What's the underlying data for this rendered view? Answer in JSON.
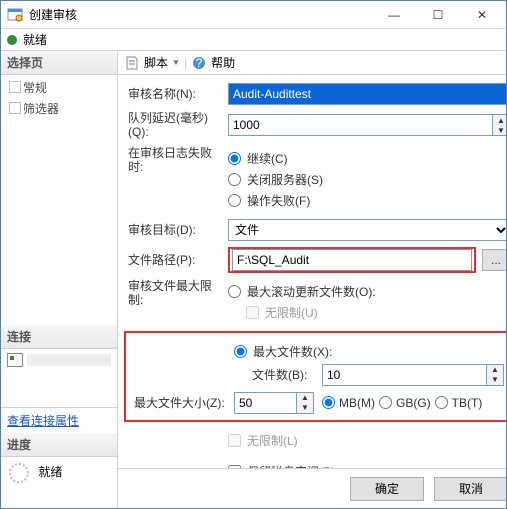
{
  "titlebar": {
    "title": "创建审核"
  },
  "status": {
    "text": "就绪"
  },
  "left": {
    "select_head": "选择页",
    "tree": {
      "general": "常规",
      "filter": "筛选器"
    },
    "conn_head": "连接",
    "view_conn": "查看连接属性",
    "progress_head": "进度",
    "progress_text": "就绪"
  },
  "toolbar": {
    "script": "脚本",
    "dropdown": "▼",
    "help": "帮助"
  },
  "form": {
    "name_label": "审核名称(N):",
    "name_value": "Audit-Audittest",
    "delay_label": "队列延迟(毫秒)(Q):",
    "delay_value": "1000",
    "onfail_label": "在审核日志失败时:",
    "onfail_continue": "继续(C)",
    "onfail_shutdown": "关闭服务器(S)",
    "onfail_failop": "操作失败(F)",
    "target_label": "审核目标(D):",
    "target_value": "文件",
    "path_label": "文件路径(P):",
    "path_value": "F:\\SQL_Audit",
    "browse": "...",
    "maxlimit_label": "审核文件最大限制:",
    "maxroll": "最大滚动更新文件数(O):",
    "nolimit1": "无限制(U)",
    "maxfiles": "最大文件数(X):",
    "filecount_label": "文件数(B):",
    "filecount_value": "10",
    "maxsize_label": "最大文件大小(Z):",
    "maxsize_value": "50",
    "mb": "MB(M)",
    "gb": "GB(G)",
    "tb": "TB(T)",
    "nolimit2": "无限制(L)",
    "reserve": "保留磁盘空间(R)"
  },
  "footer": {
    "ok": "确定",
    "cancel": "取消"
  }
}
